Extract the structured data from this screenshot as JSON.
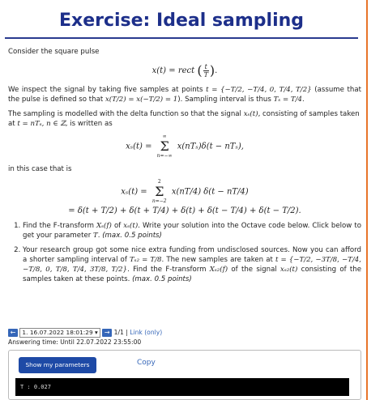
{
  "title": "Exercise: Ideal sampling",
  "intro": "Consider the square pulse",
  "eq1": {
    "lhs": "x(t) = rect",
    "num": "t",
    "den": "T",
    "tail": "."
  },
  "para1": {
    "a": "We inspect the signal by taking five samples at points ",
    "t_set": "t = {−T/2, −T/4, 0, T/4, T/2}",
    "b": " (assume that the pulse is defined so that ",
    "cond": "x(T/2) = x(−T/2) = 1",
    "c": "). Sampling interval is thus ",
    "ts": "Tₛ = T/4",
    "d": "."
  },
  "para2": {
    "a": "The sampling is modelled with the delta function so that the signal ",
    "xs": "xₛ(t)",
    "b": ", consisting of samples taken at ",
    "tn": "t = nTₛ, n ∈ ℤ",
    "c": ", is written as"
  },
  "eq2": {
    "lhs": "xₛ(t) =",
    "upper": "∞",
    "lower": "n=−∞",
    "rhs": "x(nTₛ)δ(t − nTₛ),"
  },
  "this_case": "in this case that is",
  "eq3": {
    "lhs": "xₛ(t) =",
    "upper": "2",
    "lower": "n=−2",
    "rhs": "x(nT/4) δ(t − nT/4)",
    "line2": "= δ(t + T/2) + δ(t + T/4) + δ(t) + δ(t − T/4) + δ(t − T/2)."
  },
  "tasks": [
    {
      "a": "Find the F-transform ",
      "m1": "Xₛ(f)",
      "b": " of ",
      "m2": "xₛ(t)",
      "c": ". Write your solution into the Octave code below. Click below to get your parameter ",
      "m3": "T",
      "d": ". ",
      "pts": "(max. 0.5 points)"
    },
    {
      "a": "Your research group got some nice extra funding from undisclosed sources. Now you can afford a shorter sampling interval of ",
      "m1": "Tₛ₂ = T/8",
      "b": ". The new samples are taken at ",
      "m2": "t = {−T/2, −3T/8, −T/4, −T/8, 0, T/8, T/4, 3T/8, T/2}",
      "c": ". Find the F-transform ",
      "m3": "Xₛ₂(f)",
      "d": " of the signal ",
      "m4": "xₛ₂(t)",
      "e": " consisting of the samples taken at these points. ",
      "pts": "(max. 0.5 points)"
    }
  ],
  "nav": {
    "prev": "←",
    "select_value": "1. 16.07.2022 18:01:29",
    "next": "→",
    "pages": "1/1",
    "sep": " | ",
    "link": "Link",
    "only": "(only)"
  },
  "deadline": "Answering time: Until 22.07.2022 23:55:00",
  "panel": {
    "show_button": "Show my parameters",
    "copy": "Copy",
    "console": "T :   0.027"
  },
  "colors": {
    "title": "#1d2f8a",
    "accent": "#e8742a",
    "button": "#1e4aa6",
    "link": "#3566b8"
  }
}
